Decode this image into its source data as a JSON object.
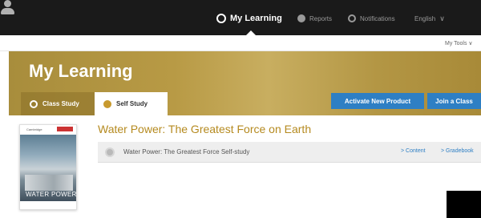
{
  "topnav": {
    "my_learning": "My Learning",
    "reports": "Reports",
    "notifications": "Notifications",
    "language": "English",
    "language_chevron": "∨"
  },
  "subnav": {
    "my_tools": "My Tools ∨"
  },
  "banner": {
    "title": "My Learning",
    "tabs": [
      {
        "label": "Class Study",
        "active": false
      },
      {
        "label": "Self Study",
        "active": true
      }
    ],
    "buttons": {
      "activate": "Activate New Product",
      "join": "Join a Class"
    }
  },
  "book": {
    "brand": "Cambridge",
    "cover_title": "WATER POWER"
  },
  "product": {
    "title": "Water Power: The Greatest Force on Earth",
    "row_label": "Water Power: The Greatest Force Self-study",
    "content_link": "> Content",
    "gradebook_link": "> Gradebook"
  },
  "colors": {
    "topbar": "#1a1a1a",
    "banner_gold": "#b89a45",
    "accent_blue": "#2e7fc4",
    "title_gold": "#b58a1f"
  },
  "icons": [
    "my-learning-icon",
    "reports-icon",
    "notifications-icon",
    "user-icon",
    "class-study-icon",
    "self-study-icon",
    "product-status-icon"
  ]
}
